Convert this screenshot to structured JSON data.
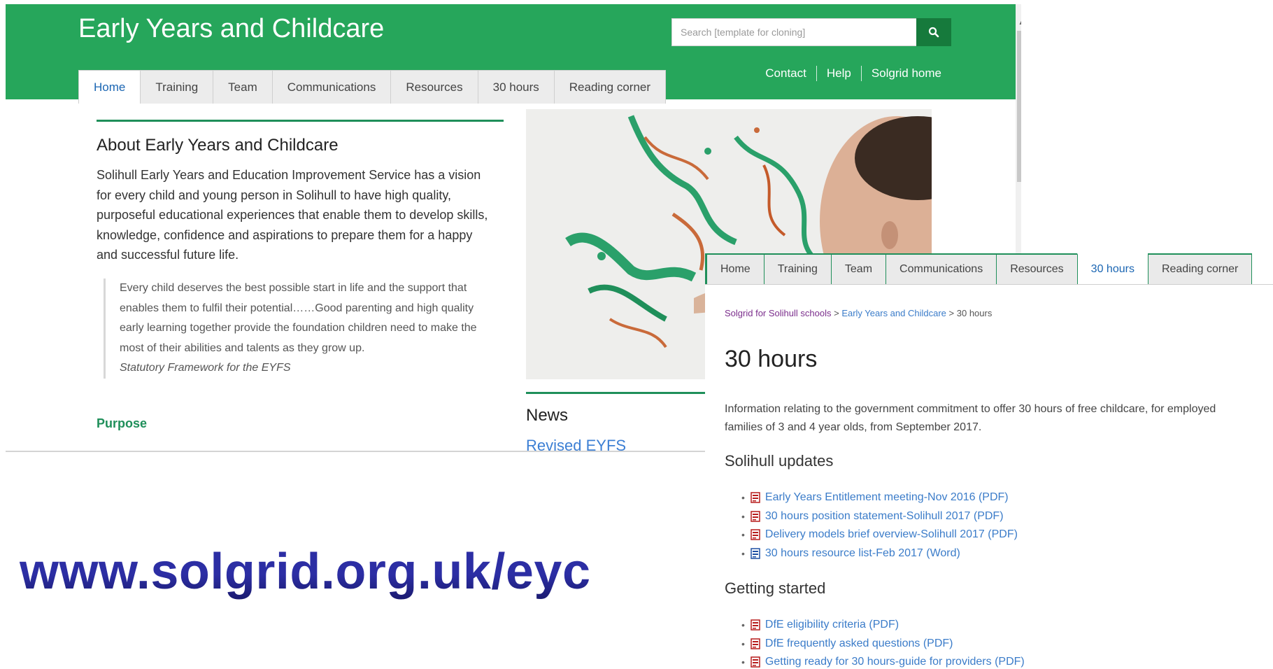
{
  "home": {
    "site_title": "Early Years and Childcare",
    "search_placeholder": "Search [template for cloning]",
    "tabs": [
      {
        "label": "Home",
        "active": true
      },
      {
        "label": "Training"
      },
      {
        "label": "Team"
      },
      {
        "label": "Communications"
      },
      {
        "label": "Resources"
      },
      {
        "label": "30 hours"
      },
      {
        "label": "Reading corner"
      }
    ],
    "top_links": [
      "Contact",
      "Help",
      "Solgrid home"
    ],
    "about_heading": "About Early Years and Childcare",
    "about_text": "Solihull Early Years and Education Improvement Service has a vision for every child and young person in Solihull to have high quality, purposeful educational experiences that enable them to develop skills, knowledge, confidence and aspirations to prepare them for a happy and successful future life.",
    "quote_text": "Every child deserves the best possible start in life and the support that enables them to fulfil their potential……Good parenting and high quality early learning together provide the foundation children need to make the most of their abilities and talents as they grow up.",
    "quote_source": "Statutory Framework for the EYFS",
    "purpose_link": "Purpose",
    "news_heading": "News",
    "news_link": "Revised EYFS"
  },
  "url": "www.solgrid.org.uk/eyc",
  "hours": {
    "tabs": [
      {
        "label": "Home"
      },
      {
        "label": "Training"
      },
      {
        "label": "Team"
      },
      {
        "label": "Communications"
      },
      {
        "label": "Resources"
      },
      {
        "label": "30 hours",
        "active": true
      },
      {
        "label": "Reading corner"
      }
    ],
    "breadcrumb": {
      "crumb1": "Solgrid for Solihull schools",
      "sep": ">",
      "crumb2": "Early Years and Childcare",
      "crumb3": "30 hours"
    },
    "title": "30 hours",
    "intro": "Information relating to the government commitment to offer 30 hours of free childcare, for employed families of 3 and 4 year olds, from September 2017.",
    "updates_heading": "Solihull updates",
    "updates": [
      {
        "label": "Early Years Entitlement meeting-Nov 2016 (PDF)",
        "icon": "pdf-icon"
      },
      {
        "label": "30 hours position statement-Solihull 2017 (PDF)",
        "icon": "pdf-icon"
      },
      {
        "label": "Delivery models brief overview-Solihull 2017 (PDF)",
        "icon": "pdf-icon"
      },
      {
        "label": "30 hours resource list-Feb 2017 (Word)",
        "icon": "word-icon"
      }
    ],
    "started_heading": "Getting started",
    "started": [
      {
        "label": "DfE eligibility criteria (PDF)",
        "icon": "pdf-icon"
      },
      {
        "label": "DfE frequently asked questions (PDF)",
        "icon": "pdf-icon"
      },
      {
        "label": "Getting ready for 30 hours-guide for providers (PDF)",
        "icon": "pdf-icon"
      }
    ]
  },
  "colors": {
    "header_green": "#26a65b",
    "link_blue": "#3b7cc9",
    "url_blue": "#2c2ea4"
  }
}
